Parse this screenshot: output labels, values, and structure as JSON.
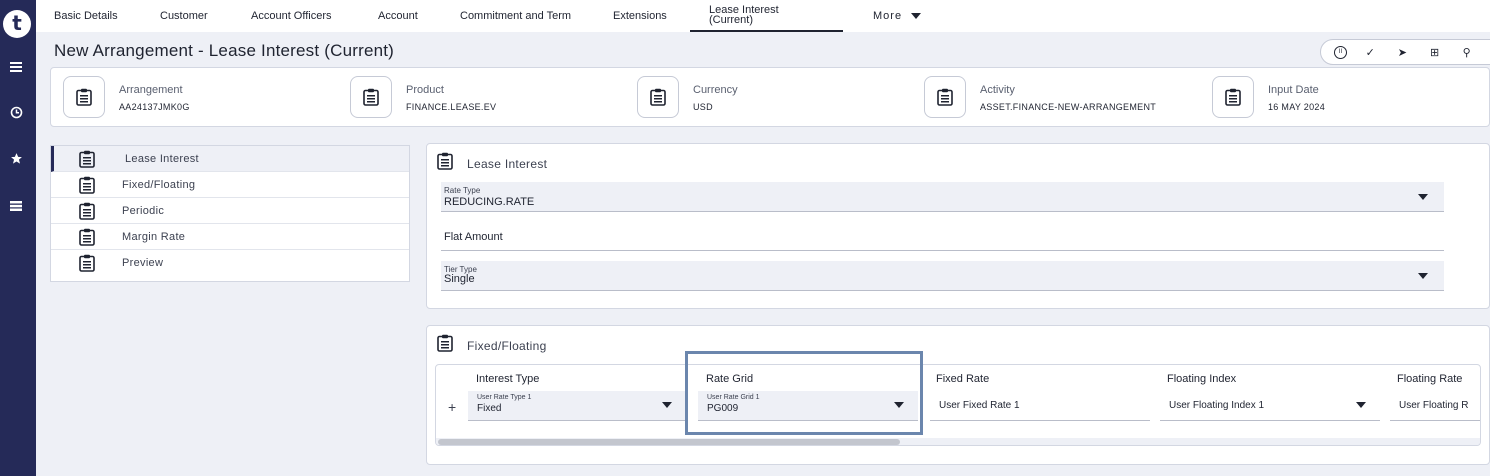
{
  "app": {
    "logo_letter": "t"
  },
  "rail_icons": [
    "menu-icon",
    "history-icon",
    "star-icon",
    "list-icon"
  ],
  "tabs": [
    {
      "label": "Basic Details"
    },
    {
      "label": "Customer"
    },
    {
      "label": "Account Officers"
    },
    {
      "label": "Account"
    },
    {
      "label": "Commitment and Term"
    },
    {
      "label": "Extensions"
    },
    {
      "label": "Lease Interest (Current)",
      "active": true
    },
    {
      "label": "More"
    }
  ],
  "title": "New Arrangement - Lease Interest (Current)",
  "toolbar": {
    "pause": "II",
    "validate": "✓",
    "commit": "➤",
    "new": "⊞",
    "search": "⚲",
    "more": "•••"
  },
  "summary": [
    {
      "label": "Arrangement",
      "value": "AA24137JMK0G"
    },
    {
      "label": "Product",
      "value": "FINANCE.LEASE.EV"
    },
    {
      "label": "Currency",
      "value": "USD"
    },
    {
      "label": "Activity",
      "value": "ASSET.FINANCE-NEW-ARRANGEMENT"
    },
    {
      "label": "Input Date",
      "value": "16 MAY 2024"
    }
  ],
  "nav": [
    {
      "label": "Lease Interest",
      "active": true
    },
    {
      "label": "Fixed/Floating"
    },
    {
      "label": "Periodic"
    },
    {
      "label": "Margin Rate"
    },
    {
      "label": "Preview"
    }
  ],
  "lease_interest": {
    "title": "Lease Interest",
    "rate_type": {
      "label": "Rate Type",
      "value": "REDUCING.RATE"
    },
    "flat_amount": {
      "placeholder": "Flat Amount"
    },
    "tier_type": {
      "label": "Tier Type",
      "value": "Single"
    }
  },
  "fixed_floating": {
    "title": "Fixed/Floating",
    "add": "+",
    "columns": [
      {
        "header": "Interest Type",
        "field_label": "User Rate Type 1",
        "value": "Fixed"
      },
      {
        "header": "Rate Grid",
        "field_label": "User Rate Grid 1",
        "value": "PG009"
      },
      {
        "header": "Fixed Rate",
        "placeholder": "User Fixed Rate 1"
      },
      {
        "header": "Floating Index",
        "placeholder": "User Floating Index 1"
      },
      {
        "header": "Floating Rate",
        "placeholder": "User Floating R"
      }
    ]
  },
  "colors": {
    "rail": "#252a58",
    "highlight": "#6b86ad",
    "field_bg": "#eef0f6"
  }
}
